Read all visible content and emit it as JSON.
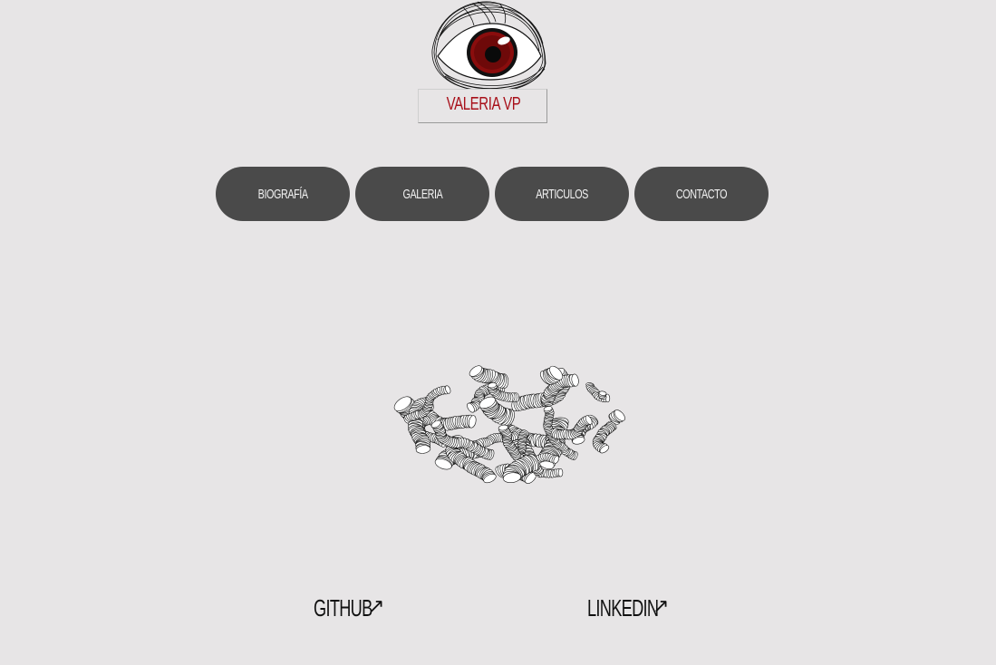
{
  "logo": {
    "text": "Valeria VP",
    "accent_color": "#a8101a"
  },
  "nav": {
    "items": [
      {
        "label": "Biografía"
      },
      {
        "label": "Galeria"
      },
      {
        "label": "Articulos"
      },
      {
        "label": "Contacto"
      }
    ],
    "button_color": "#4a4a4a",
    "text_color": "#f2f2f2"
  },
  "footer": {
    "github_label": "GitHub",
    "linkedin_label": "Linkedin",
    "arrow_glyph": "↗"
  },
  "colors": {
    "background": "#e7e5e6"
  }
}
